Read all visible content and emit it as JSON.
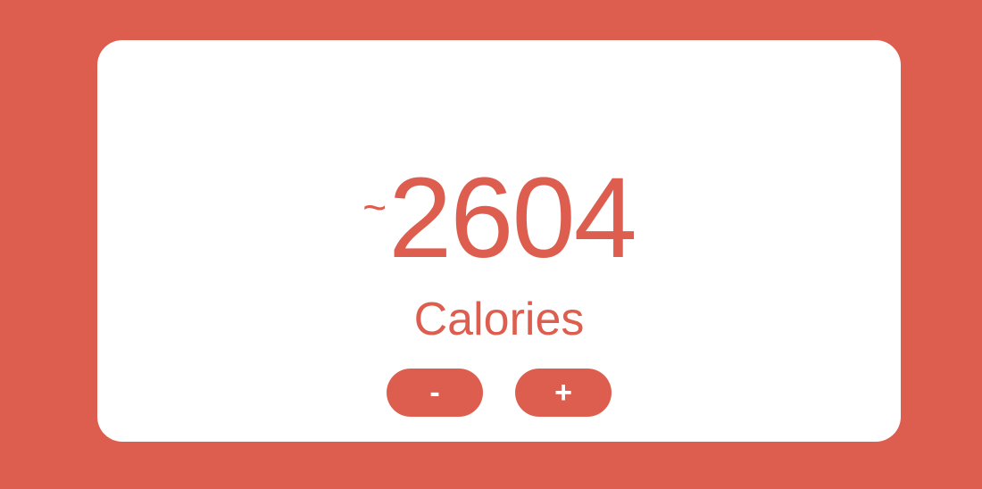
{
  "calorie_counter": {
    "approx_symbol": "~",
    "value": "2604",
    "unit_label": "Calories",
    "decrease_label": "-",
    "increase_label": "+"
  },
  "colors": {
    "accent": "#dd5e4f",
    "card_background": "#ffffff",
    "button_text": "#ffffff"
  }
}
